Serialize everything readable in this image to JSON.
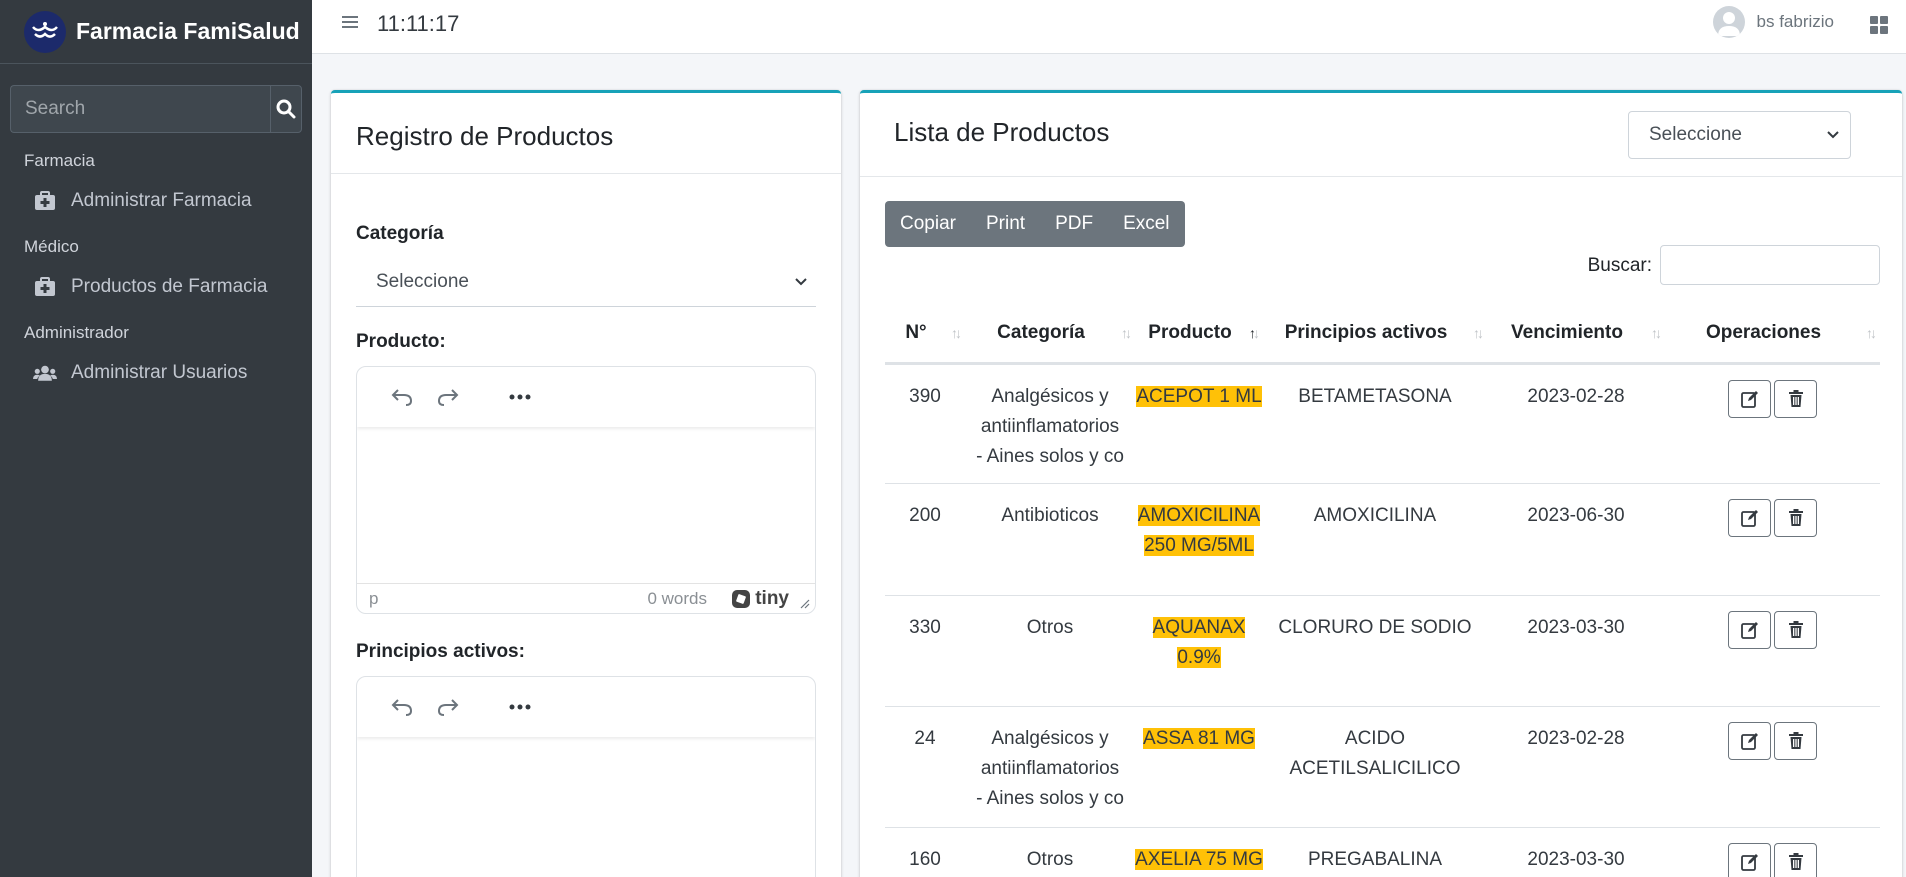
{
  "sidebar": {
    "brand": "Farmacia FamiSalud",
    "search_placeholder": "Search",
    "sections": [
      {
        "header": "Farmacia",
        "item": "Administrar Farmacia"
      },
      {
        "header": "Médico",
        "item": "Productos de Farmacia"
      },
      {
        "header": "Administrador",
        "item": "Administrar Usuarios"
      }
    ]
  },
  "topbar": {
    "clock": "11:11:17",
    "user_name": "bs fabrizio"
  },
  "form": {
    "title": "Registro de Productos",
    "categoria_label": "Categoría",
    "categoria_value": "Seleccione",
    "producto_label": "Producto:",
    "principios_label": "Principios activos:",
    "editor_path": "p",
    "editor_words": "0 words",
    "editor_brand": "tiny"
  },
  "list": {
    "title": "Lista de Productos",
    "filter_value": "Seleccione",
    "buttons": [
      "Copiar",
      "Print",
      "PDF",
      "Excel"
    ],
    "buscar_label": "Buscar:",
    "columns": [
      "N°",
      "Categoría",
      "Producto",
      "Principios activos",
      "Vencimiento",
      "Operaciones"
    ],
    "rows": [
      {
        "n": "390",
        "categoria": [
          "Analgésicos y",
          "antiinflamatorios",
          "- Aines solos y co"
        ],
        "producto": [
          "ACEPOT 1 ML"
        ],
        "principio": [
          "BETAMETASONA"
        ],
        "vencimiento": "2023-02-28"
      },
      {
        "n": "200",
        "categoria": [
          "Antibioticos"
        ],
        "producto": [
          "AMOXICILINA",
          "250 MG/5ML"
        ],
        "principio": [
          "AMOXICILINA"
        ],
        "vencimiento": "2023-06-30"
      },
      {
        "n": "330",
        "categoria": [
          "Otros"
        ],
        "producto": [
          "AQUANAX",
          "0.9%"
        ],
        "principio": [
          "CLORURO DE SODIO"
        ],
        "vencimiento": "2023-03-30"
      },
      {
        "n": "24",
        "categoria": [
          "Analgésicos y",
          "antiinflamatorios",
          "- Aines solos y co"
        ],
        "producto": [
          "ASSA 81 MG"
        ],
        "principio": [
          "ACIDO",
          "ACETILSALICILICO"
        ],
        "vencimiento": "2023-02-28"
      },
      {
        "n": "160",
        "categoria": [
          "Otros"
        ],
        "producto": [
          "AXELIA 75 MG"
        ],
        "principio": [
          "PREGABALINA"
        ],
        "vencimiento": "2023-03-30"
      }
    ]
  },
  "colors": {
    "sidebar_bg": "#343a40",
    "card_accent": "#17a2b8",
    "highlight": "#ffc107",
    "button_group": "#6c757d"
  }
}
